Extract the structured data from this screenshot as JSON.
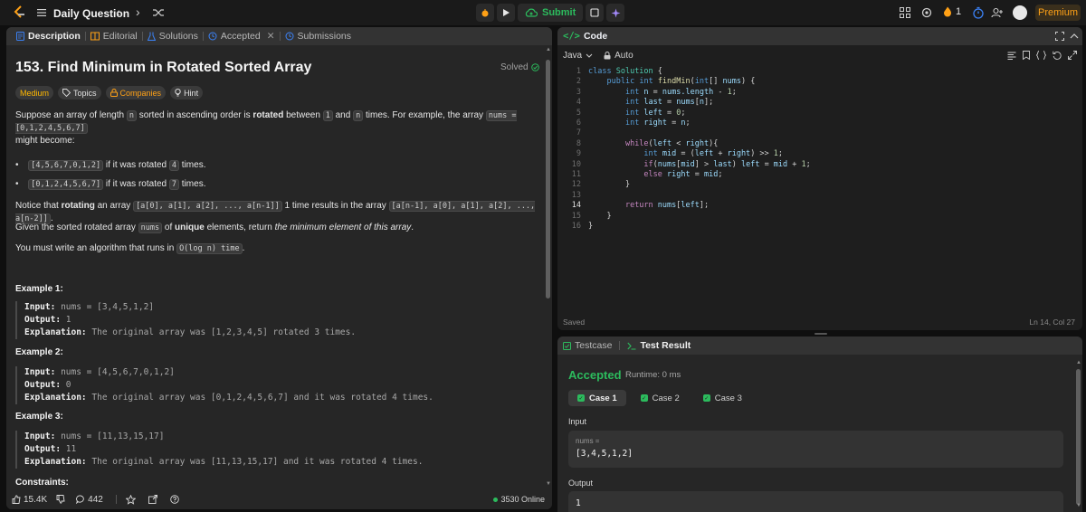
{
  "topbar": {
    "title": "Daily Question",
    "prev": "‹",
    "next": "›",
    "submit_label": "Submit",
    "streak_count": "1",
    "premium_label": "Premium"
  },
  "left_tabs": [
    {
      "label": "Description"
    },
    {
      "label": "Editorial"
    },
    {
      "label": "Solutions"
    },
    {
      "label": "Accepted"
    },
    {
      "label": "Submissions"
    }
  ],
  "problem": {
    "title": "153. Find Minimum in Rotated Sorted Array",
    "solved_label": "Solved",
    "tags": [
      "Medium",
      "Topics",
      "Companies",
      "Hint"
    ],
    "p1_a": "Suppose an array of length",
    "p1_n": "n",
    "p1_b": "sorted in ascending order is",
    "p1_rot": "rotated",
    "p1_c": "between",
    "p1_one": "1",
    "p1_d": "and",
    "p1_n2": "n",
    "p1_e": "times. For example, the array",
    "p1_code": "nums = [0,1,2,4,5,6,7]",
    "p1_f": "might become:",
    "b1_code": "[4,5,6,7,0,1,2]",
    "b1_text": "if it was rotated",
    "b1_num": "4",
    "b1_end": "times.",
    "b2_code": "[0,1,2,4,5,6,7]",
    "b2_text": "if it was rotated",
    "b2_num": "7",
    "b2_end": "times.",
    "p2_a": "Notice that",
    "p2_rot": "rotating",
    "p2_b": "an array",
    "p2_code1": "[a[0], a[1], a[2], ..., a[n-1]]",
    "p2_c": "1 time results in the array",
    "p2_code2": "[a[n-1], a[0], a[1], a[2], ..., a[n-2]]",
    "p2_d": ".",
    "p3_a": "Given the sorted rotated array",
    "p3_code": "nums",
    "p3_b": "of",
    "p3_uniq": "unique",
    "p3_c": "elements, return",
    "p3_em": "the minimum element of this array",
    "p3_d": ".",
    "p4_a": "You must write an algorithm that runs in",
    "p4_code": "O(log n) time",
    "p4_b": ".",
    "examples": [
      {
        "h": "Example 1:",
        "input": "nums = [3,4,5,1,2]",
        "output": "1",
        "expl": "The original array was [1,2,3,4,5] rotated 3 times."
      },
      {
        "h": "Example 2:",
        "input": "nums = [4,5,6,7,0,1,2]",
        "output": "0",
        "expl": "The original array was [0,1,2,4,5,6,7] and it was rotated 4 times."
      },
      {
        "h": "Example 3:",
        "input": "nums = [11,13,15,17]",
        "output": "11",
        "expl": "The original array was [11,13,15,17] and it was rotated 4 times."
      }
    ],
    "input_label": "Input:",
    "output_label": "Output:",
    "expl_label": "Explanation:",
    "constraints": "Constraints:"
  },
  "footer": {
    "likes": "15.4K",
    "comments": "442",
    "online": "3530 Online"
  },
  "code": {
    "header": "Code",
    "icon": "</>",
    "language": "Java",
    "mode": "Auto",
    "line_numbers": [
      "1",
      "2",
      "3",
      "4",
      "5",
      "6",
      "7",
      "8",
      "9",
      "10",
      "11",
      "12",
      "13",
      "14",
      "15",
      "16"
    ],
    "saved": "Saved",
    "cursor": "Ln 14, Col 27"
  },
  "test": {
    "tab_testcase": "Testcase",
    "tab_result": "Test Result",
    "status": "Accepted",
    "runtime": "Runtime: 0 ms",
    "cases": [
      "Case 1",
      "Case 2",
      "Case 3"
    ],
    "input_label": "Input",
    "var_name": "nums =",
    "var_value": "[3,4,5,1,2]",
    "output_label": "Output",
    "output_value": "1"
  },
  "colors": {
    "accent_green": "#2cbb5d",
    "premium_orange": "#ffa116",
    "medium_yellow": "#ffb800"
  }
}
